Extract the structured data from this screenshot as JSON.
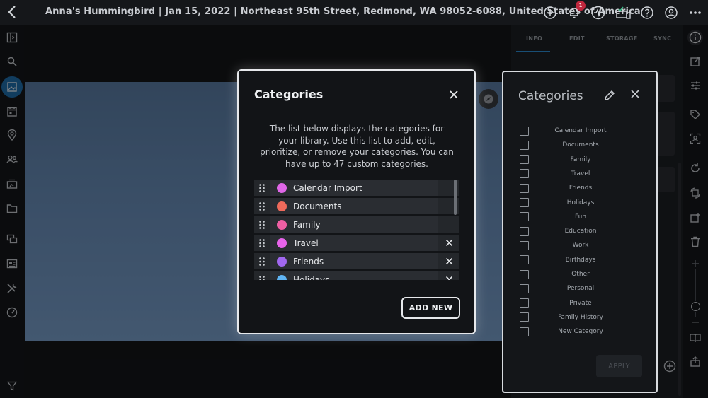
{
  "header": {
    "back_icon": "chevron-left-icon",
    "title": "Anna's Hummingbird | Jan 15, 2022 | Northeast 95th Street, Redmond, WA 98052-6088, United States of America",
    "notification_count": "1"
  },
  "info_panel": {
    "tabs": [
      "INFO",
      "EDIT",
      "STORAGE",
      "SYNC"
    ],
    "active_tab": "INFO"
  },
  "modal": {
    "title": "Categories",
    "description": "The list below displays the categories for your library. Use this list to add, edit, prioritize, or remove your categories. You can have up to 47 custom categories.",
    "items": [
      {
        "label": "Calendar Import",
        "color": "#e067e8",
        "removable": false
      },
      {
        "label": "Documents",
        "color": "#ef6a5b",
        "removable": false
      },
      {
        "label": "Family",
        "color": "#ee5fa3",
        "removable": false
      },
      {
        "label": "Travel",
        "color": "#e763ea",
        "removable": true
      },
      {
        "label": "Friends",
        "color": "#a167f0",
        "removable": true
      },
      {
        "label": "Holidays",
        "color": "#5fb4f3",
        "removable": true
      }
    ],
    "add_new_label": "ADD NEW"
  },
  "category_panel": {
    "title": "Categories",
    "items": [
      "Calendar Import",
      "Documents",
      "Family",
      "Travel",
      "Friends",
      "Holidays",
      "Fun",
      "Education",
      "Work",
      "Birthdays",
      "Other",
      "Personal",
      "Private",
      "Family History",
      "New Category"
    ],
    "apply_label": "APPLY"
  },
  "colors": {
    "accent": "#2d8fd6",
    "notification": "#c0273d"
  }
}
